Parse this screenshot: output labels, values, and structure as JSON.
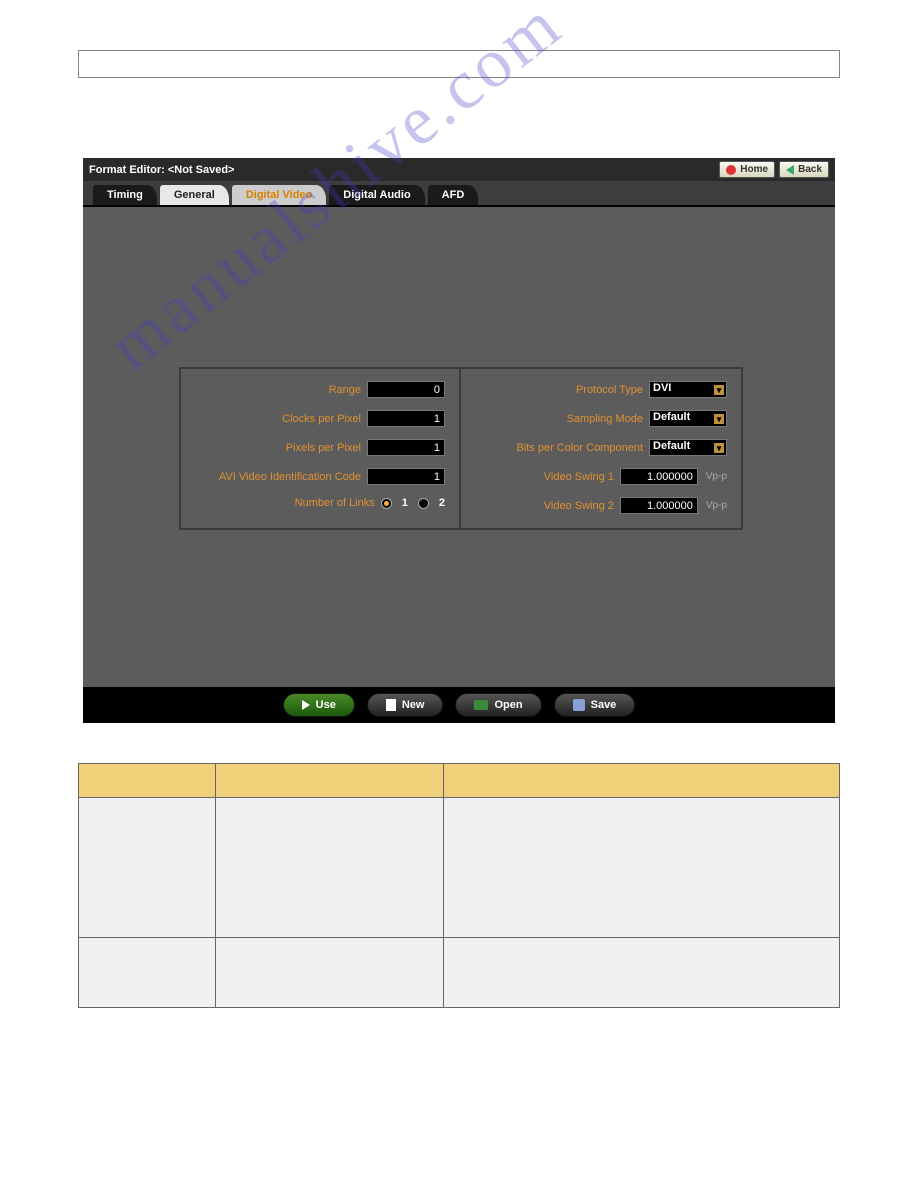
{
  "titleBar": {
    "title": "Format Editor: <Not Saved>",
    "homeBtn": "Home",
    "backBtn": "Back"
  },
  "tabs": {
    "timing": "Timing",
    "general": "General",
    "digitalVideo": "Digital Video",
    "digitalAudio": "Digital Audio",
    "afd": "AFD"
  },
  "leftFields": {
    "range": {
      "label": "Range",
      "value": "0"
    },
    "clocksPerPixel": {
      "label": "Clocks per Pixel",
      "value": "1"
    },
    "pixelsPerPixel": {
      "label": "Pixels per Pixel",
      "value": "1"
    },
    "aviCode": {
      "label": "AVI Video Identification Code",
      "value": "1"
    },
    "numberOfLinks": {
      "label": "Number of Links",
      "opt1": "1",
      "opt2": "2"
    }
  },
  "rightFields": {
    "protocolType": {
      "label": "Protocol Type",
      "value": "DVI"
    },
    "samplingMode": {
      "label": "Sampling Mode",
      "value": "Default"
    },
    "bitsPerColor": {
      "label": "Bits per Color Component",
      "value": "Default"
    },
    "videoSwing1": {
      "label": "Video Swing 1",
      "value": "1.000000",
      "unit": "Vp-p"
    },
    "videoSwing2": {
      "label": "Video Swing 2",
      "value": "1.000000",
      "unit": "Vp-p"
    }
  },
  "footerButtons": {
    "use": "Use",
    "new": "New",
    "open": "Open",
    "save": "Save"
  },
  "watermark": "manualshive.com"
}
